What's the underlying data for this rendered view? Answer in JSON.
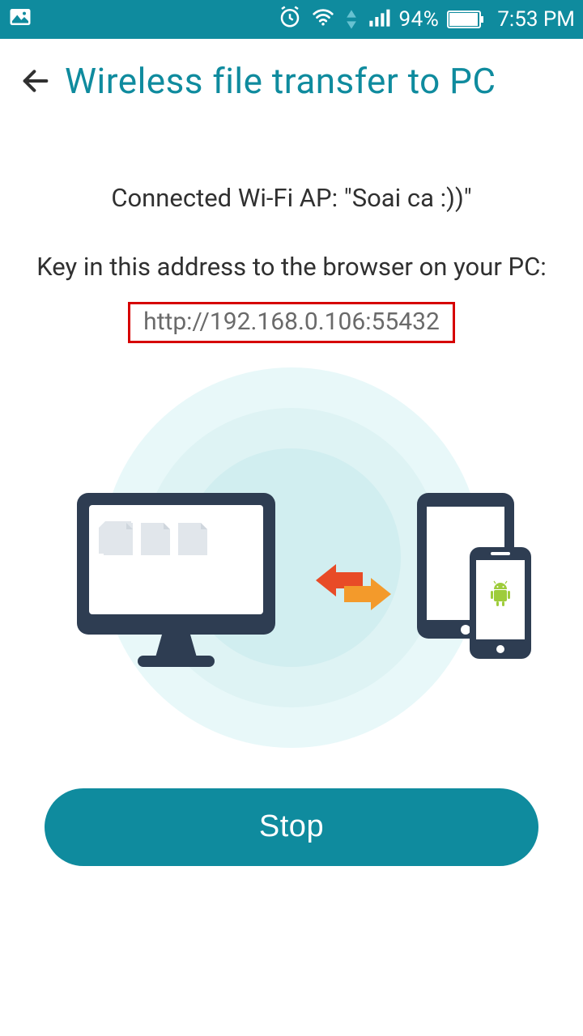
{
  "status_bar": {
    "battery_pct": "94%",
    "time": "7:53 PM"
  },
  "header": {
    "title": "Wireless file transfer to PC"
  },
  "main": {
    "connected_label": "Connected Wi-Fi AP: \"Soai ca :))\"",
    "instruction": "Key in this address to the browser on your PC:",
    "url": "http://192.168.0.106:55432",
    "stop_label": "Stop"
  }
}
